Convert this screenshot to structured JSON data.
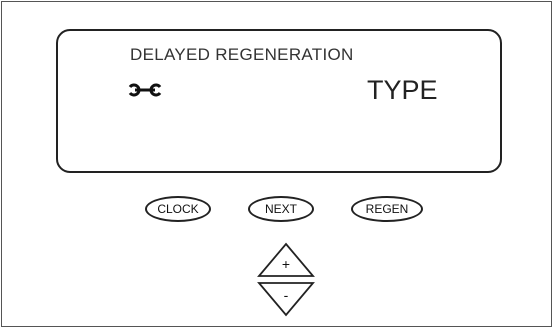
{
  "display": {
    "line1": "DELAYED REGENERATION",
    "line2": "TYPE",
    "icon": "wrench-icon"
  },
  "buttons": {
    "clock": "CLOCK",
    "next": "NEXT",
    "regen": "REGEN",
    "up": "+",
    "down": "-"
  }
}
